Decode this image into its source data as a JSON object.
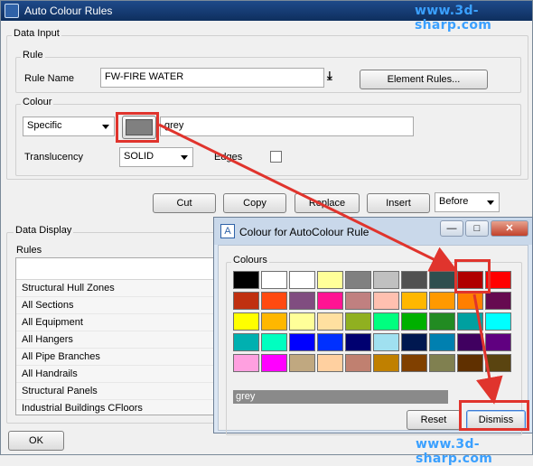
{
  "main_window": {
    "title": "Auto Colour Rules",
    "watermark": "www.3d-sharp.com"
  },
  "data_input": {
    "group_label": "Data Input",
    "rule": {
      "group_label": "Rule",
      "name_label": "Rule Name",
      "name_value": "FW-FIRE WATER",
      "element_rules_button": "Element Rules..."
    },
    "colour": {
      "group_label": "Colour",
      "mode_value": "Specific",
      "swatch_color": "#808080",
      "colour_value": "grey",
      "translucency_label": "Translucency",
      "translucency_value": "SOLID",
      "edges_label": "Edges"
    },
    "actions": {
      "cut": "Cut",
      "copy": "Copy",
      "replace": "Replace",
      "insert": "Insert",
      "position_value": "Before"
    }
  },
  "data_display": {
    "group_label": "Data Display",
    "rules_label": "Rules",
    "rules": [
      "Structural Hull Zones",
      "All Sections",
      "All Equipment",
      "All Hangers",
      "All Pipe Branches",
      "All Handrails",
      "Structural Panels",
      "Industrial Buildings CFloors"
    ],
    "ok_button": "OK"
  },
  "dialog": {
    "title": "Colour for AutoColour Rule",
    "colours_label": "Colours",
    "selected_colour": "grey",
    "reset_button": "Reset",
    "dismiss_button": "Dismiss",
    "watermark": "www.3d-sharp.com",
    "swatches": [
      "#000000",
      "#ffffff",
      "#ffffff",
      "#ffff99",
      "#808080",
      "#c0c0c0",
      "#505050",
      "#2f4f4f",
      "#b00000",
      "#ff0000",
      "#c03010",
      "#ff4a10",
      "#804d80",
      "#ff1493",
      "#c08080",
      "#ffc0b0",
      "#ffb700",
      "#ff9900",
      "#ff7f00",
      "#660a50",
      "#ffff00",
      "#ffb700",
      "#ffff99",
      "#ffe0a0",
      "#90b020",
      "#00ff7f",
      "#00b000",
      "#228b22",
      "#00a0a0",
      "#00ffff",
      "#00b0b0",
      "#00ffc0",
      "#0000ff",
      "#0030ff",
      "#000070",
      "#a0e0f0",
      "#001850",
      "#0080b0",
      "#400060",
      "#600080",
      "#ffa0e0",
      "#ff00ff",
      "#c0a880",
      "#ffd0a0",
      "#c08070",
      "#c08000",
      "#804000",
      "#808050",
      "#603000",
      "#5a4410"
    ]
  }
}
